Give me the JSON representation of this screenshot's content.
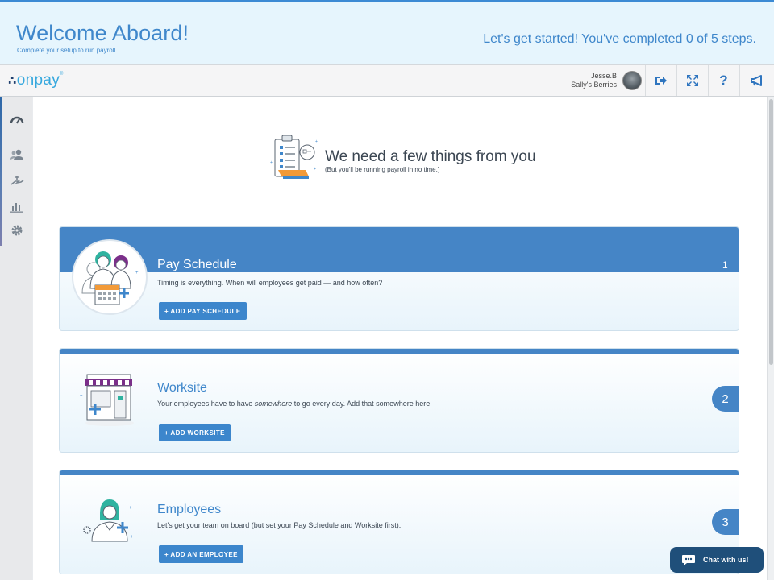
{
  "banner": {
    "title": "Welcome Aboard!",
    "subtitle": "Complete your setup to run payroll.",
    "progress": "Let's get started! You've completed 0 of 5 steps."
  },
  "header": {
    "logo": "onpay",
    "user_name": "Jesse.B",
    "company": "Sally's Berries",
    "buttons": [
      {
        "icon": "sign-out-icon",
        "label": "➜"
      },
      {
        "icon": "fullscreen-icon",
        "label": "⤢"
      },
      {
        "icon": "help-icon",
        "label": "?"
      },
      {
        "icon": "announcement-icon",
        "label": "📢"
      }
    ]
  },
  "sidebar": {
    "items": [
      {
        "icon": "dashboard-gauge-icon"
      },
      {
        "icon": "people-icon"
      },
      {
        "icon": "payroll-hand-icon"
      },
      {
        "icon": "reports-chart-icon"
      },
      {
        "icon": "settings-gear-icon"
      }
    ]
  },
  "intro": {
    "title": "We need a few things from you",
    "subtitle": "(But you'll be running payroll in no time.)"
  },
  "steps": [
    {
      "number": "1",
      "title": "Pay Schedule",
      "description": "Timing is everything. When will employees get paid — and how often?",
      "button": "+ ADD PAY SCHEDULE"
    },
    {
      "number": "2",
      "title": "Worksite",
      "description_pre": "Your employees have to have ",
      "description_em": "somewhere",
      "description_post": " to go every day. Add that somewhere here.",
      "button": "+ ADD WORKSITE"
    },
    {
      "number": "3",
      "title": "Employees",
      "description": "Let's get your team on board (but set your Pay Schedule and Worksite first).",
      "button": "+ ADD AN EMPLOYEE"
    }
  ],
  "chat": {
    "label": "Chat with us!"
  },
  "colors": {
    "accent": "#3f87cb",
    "bar": "#4585c6",
    "button": "#3c86cc",
    "chat": "#1f4f7a"
  }
}
